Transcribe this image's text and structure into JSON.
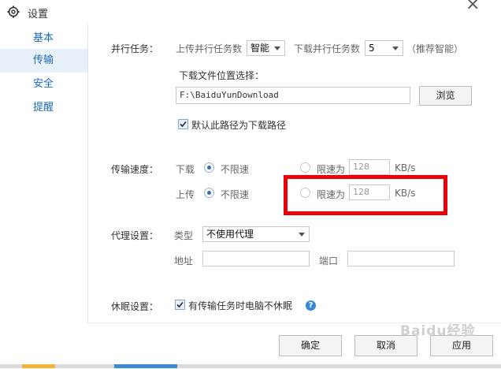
{
  "window": {
    "title": "设置",
    "close_glyph": "×"
  },
  "sidebar": {
    "items": [
      {
        "label": "基本"
      },
      {
        "label": "传输"
      },
      {
        "label": "安全"
      },
      {
        "label": "提醒"
      }
    ]
  },
  "parallel": {
    "section_label": "并行任务：",
    "upload_label": "上传并行任务数",
    "upload_value": "智能",
    "download_label": "下载并行任务数",
    "download_value": "5",
    "recommend": "（推荐智能）"
  },
  "download_location": {
    "label": "下载文件位置选择：",
    "path": "F:\\BaiduYunDownload",
    "browse_label": "浏览",
    "default_checkbox_label": "默认此路径为下载路径",
    "default_checked": true
  },
  "speed": {
    "section_label": "传输速度：",
    "download_label": "下载",
    "upload_label": "上传",
    "unlimited_label": "不限速",
    "limit_label": "限速为",
    "download_limit_value": "128",
    "upload_limit_value": "128",
    "unit": "KB/s",
    "download_mode": "unlimited",
    "upload_mode": "unlimited"
  },
  "proxy": {
    "section_label": "代理设置：",
    "type_label": "类型",
    "type_value": "不使用代理",
    "address_label": "地址",
    "address_value": "",
    "port_label": "端口",
    "port_value": ""
  },
  "sleep": {
    "section_label": "休眠设置：",
    "checkbox_label": "有传输任务时电脑不休眠",
    "checked": true,
    "help_glyph": "?"
  },
  "footer": {
    "ok_label": "确定",
    "cancel_label": "取消",
    "apply_label": "应用"
  },
  "watermark": {
    "text": "Baidu经验"
  },
  "colors": {
    "highlight_border": "#e8000b",
    "sidebar_text": "#1a6bb8",
    "sidebar_active_bg": "#e8f0fa"
  }
}
